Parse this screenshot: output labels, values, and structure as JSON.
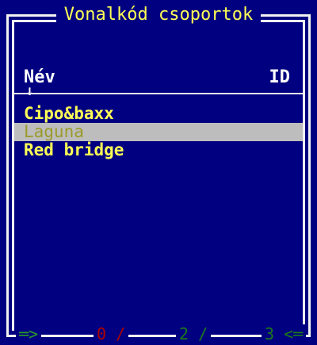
{
  "window": {
    "title": "Vonalkód csoportok"
  },
  "columns": {
    "name_label": "Név",
    "id_label": "ID",
    "sort_arrow": "↓"
  },
  "list": {
    "items": [
      {
        "label": "Cipo&baxx",
        "selected": false
      },
      {
        "label": "Laguna",
        "selected": true
      },
      {
        "label": "Red bridge",
        "selected": false
      }
    ]
  },
  "status_bar": {
    "left_marker": "═>",
    "count_a": "0 /",
    "count_b": "2 /",
    "count_c": "3 <═"
  },
  "colors": {
    "background": "#000080",
    "title_text": "#ffff55",
    "item_text": "#ffff55",
    "selection_bg": "#bdbdbd",
    "frame": "#f2f2f2"
  }
}
